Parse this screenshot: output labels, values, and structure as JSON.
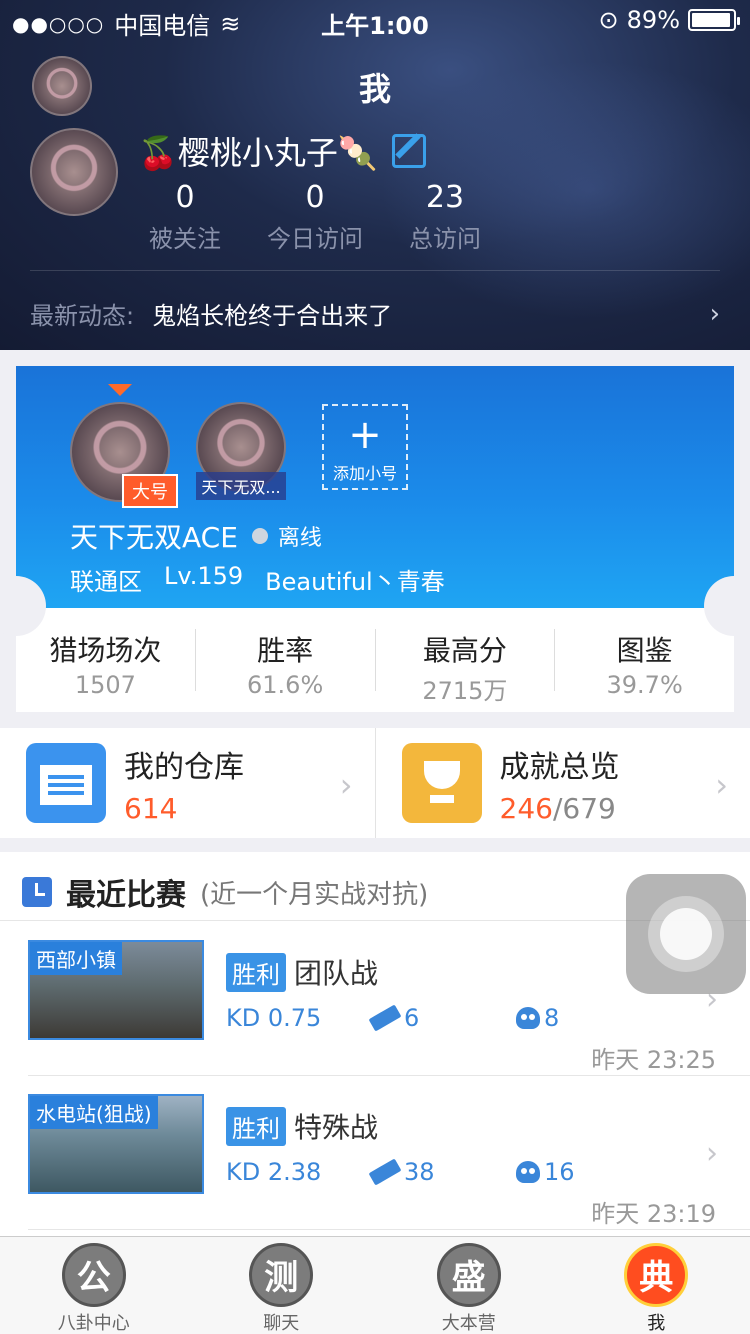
{
  "status_bar": {
    "carrier": "中国电信",
    "time": "上午1:00",
    "battery": "89%"
  },
  "header": {
    "title": "我",
    "username": "🍒樱桃小丸子🍡",
    "stats": [
      {
        "value": "0",
        "label": "被关注"
      },
      {
        "value": "0",
        "label": "今日访问"
      },
      {
        "value": "23",
        "label": "总访问"
      }
    ],
    "latest_label": "最新动态:",
    "latest_text": "鬼焰长枪终于合出来了"
  },
  "account_card": {
    "main_tag": "大号",
    "sub_account_name": "天下无双...",
    "add_label": "添加小号",
    "name": "天下无双ACE",
    "status": "离线",
    "server": "联通区",
    "level": "Lv.159",
    "motto": "Beautiful丶青春",
    "stats": [
      {
        "title": "猎场场次",
        "value": "1507"
      },
      {
        "title": "胜率",
        "value": "61.6%"
      },
      {
        "title": "最高分",
        "value": "2715万"
      },
      {
        "title": "图鉴",
        "value": "39.7%"
      }
    ]
  },
  "shortcuts": {
    "warehouse_title": "我的仓库",
    "warehouse_count": "614",
    "achievement_title": "成就总览",
    "achievement_count": "246",
    "achievement_total": "/679"
  },
  "recent": {
    "title": "最近比赛",
    "subtitle": "(近一个月实战对抗)",
    "matches": [
      {
        "map": "西部小镇",
        "result": "胜利",
        "mode": "团队战",
        "kd": "KD 0.75",
        "kills": "6",
        "deaths": "8",
        "time": "昨天 23:25"
      },
      {
        "map": "水电站(狙战)",
        "result": "胜利",
        "mode": "特殊战",
        "kd": "KD 2.38",
        "kills": "38",
        "deaths": "16",
        "time": "昨天 23:19"
      }
    ]
  },
  "tabbar": [
    {
      "icon": "公",
      "label": "八卦中心"
    },
    {
      "icon": "测",
      "label": "聊天"
    },
    {
      "icon": "盛",
      "label": "大本营"
    },
    {
      "icon": "典",
      "label": "我"
    }
  ]
}
